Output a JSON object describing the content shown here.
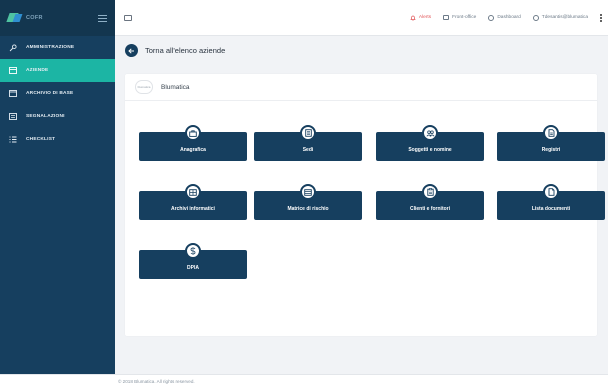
{
  "brand": {
    "name": "COFR",
    "logo_icon": "cofr-logo-icon",
    "menu_icon": "hamburger-icon"
  },
  "sidebar": {
    "items": [
      {
        "label": "AMMINISTRAZIONE",
        "icon": "key-icon",
        "active": false
      },
      {
        "label": "AZIENDE",
        "icon": "card-icon",
        "active": true
      },
      {
        "label": "ARCHIVIO DI BASE",
        "icon": "folder-icon",
        "active": false
      },
      {
        "label": "SEGNALAZIONI",
        "icon": "flag-icon",
        "active": false
      },
      {
        "label": "CHECKLIST",
        "icon": "list-icon",
        "active": false
      }
    ]
  },
  "topbar": {
    "alert_label": "Alerts",
    "front_office_label": "Front-office",
    "dashboard_label": "Dashboard",
    "user_label": "Tdesantis@blumatica"
  },
  "main": {
    "back_label": "Torna all'elenco aziende",
    "company_name": "Blumatica",
    "company_logo_text": "blumatica"
  },
  "tiles": [
    {
      "label": "Anagrafica",
      "icon": "briefcase-icon"
    },
    {
      "label": "Sedi",
      "icon": "building-icon"
    },
    {
      "label": "Soggetti e nomine",
      "icon": "people-icon"
    },
    {
      "label": "Registri",
      "icon": "document-icon"
    },
    {
      "label": "Archivi informatici",
      "icon": "archive-icon"
    },
    {
      "label": "Matrice di rischio",
      "icon": "matrix-icon"
    },
    {
      "label": "Clienti e fornitori",
      "icon": "clipboard-icon"
    },
    {
      "label": "Lista documenti",
      "icon": "files-icon"
    },
    {
      "label": "DPIA",
      "icon": "dollar-icon"
    }
  ],
  "footer": {
    "text": "© 2018 Blumatica. All rights reserved."
  },
  "colors": {
    "sidebar": "#163f5f",
    "active": "#1cb5a4",
    "tile": "#163f5f",
    "background": "#f1f3f6",
    "alert": "#e2575a"
  }
}
